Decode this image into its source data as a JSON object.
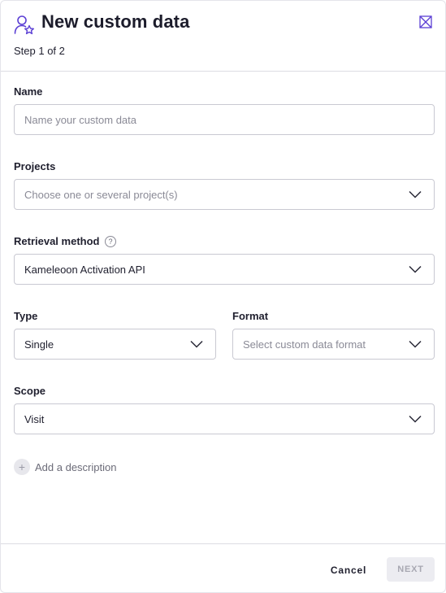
{
  "header": {
    "icon": "user-star-icon",
    "title": "New custom data",
    "step": "Step 1 of 2",
    "close_icon": "close-icon",
    "accent_color": "#5b3fd4"
  },
  "form": {
    "name": {
      "label": "Name",
      "placeholder": "Name your custom data",
      "value": ""
    },
    "projects": {
      "label": "Projects",
      "placeholder": "Choose one or several project(s)"
    },
    "retrieval": {
      "label": "Retrieval method",
      "help": "?",
      "value": "Kameleoon Activation API"
    },
    "type": {
      "label": "Type",
      "value": "Single"
    },
    "format": {
      "label": "Format",
      "placeholder": "Select custom data format"
    },
    "scope": {
      "label": "Scope",
      "value": "Visit"
    },
    "add_description": {
      "icon": "+",
      "label": "Add a description"
    }
  },
  "footer": {
    "cancel_label": "Cancel",
    "next_label": "NEXT"
  }
}
